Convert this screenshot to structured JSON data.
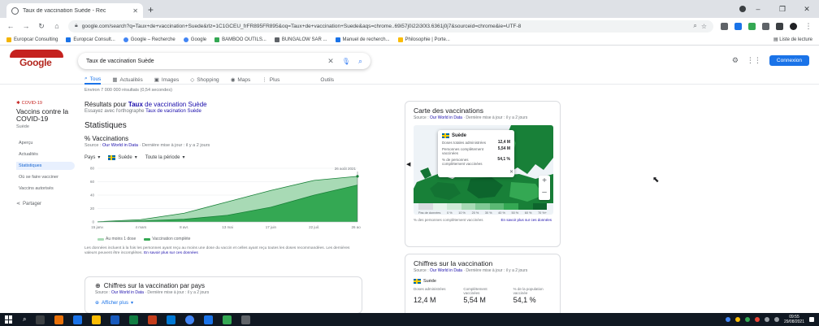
{
  "browser": {
    "tab_title": "Taux de vaccination Suède - Rec",
    "new_tab": "+",
    "url": "google.com/search?q=Taux+de+vaccination+Suede&rlz=1C1GCEU_frFR895FR895&oq=Taux+de+vaccination+Suede&aqs=chrome..69i57j0i22i30l3.6361j0j7&sourceid=chrome&ie=UTF-8",
    "window_controls": [
      "–",
      "❐",
      "✕"
    ],
    "bookmarks": [
      {
        "label": "Europcar Consulting",
        "color": "#f4b400"
      },
      {
        "label": "Europcar Consult...",
        "color": "#1a73e8"
      },
      {
        "label": "Google – Recherche",
        "color": "#4285f4"
      },
      {
        "label": "Google",
        "color": "#4285f4"
      },
      {
        "label": "BAMBOO OUTILS...",
        "color": "#34a853"
      },
      {
        "label": "BUNGALOW SAR ...",
        "color": "#5f6368"
      },
      {
        "label": "Manuel de recherch...",
        "color": "#1a73e8"
      },
      {
        "label": "Philosophie | Porte...",
        "color": "#fbbc04"
      }
    ],
    "reading_list": "Liste de lecture"
  },
  "search": {
    "logo_text": "Google",
    "query": "Taux de vaccination Suède",
    "signin": "Connexion",
    "tabs": [
      "Tous",
      "Actualités",
      "Images",
      "Shopping",
      "Maps",
      "Plus"
    ],
    "tools": "Outils",
    "result_stats": "Environ 7 000 000 résultats (0,54 secondes)"
  },
  "sidebar": {
    "tag": "COVID-19",
    "title": "Vaccins contre la COVID-19",
    "subtitle": "Suède",
    "items": [
      "Aperçu",
      "Actualités",
      "Statistiques",
      "Où se faire vacciner",
      "Vaccins autorisés"
    ],
    "share": "Partager"
  },
  "main": {
    "results_for_prefix": "Résultats pour ",
    "results_for_bold": "Taux",
    "results_for_rest": " de vaccination Suède",
    "instead_prefix": "Essayez avec l'orthographe ",
    "instead_link": "Taux de vacination Suède",
    "stats_heading": "Statistiques",
    "vacc_heading": "% Vaccinations",
    "source_prefix": "Source : ",
    "source_link": "Our World in Data",
    "source_updated": " · Dernière mise à jour : il y a 2 jours",
    "filter_scope": "Pays",
    "filter_country": "Suède",
    "filter_period": "Toute la période",
    "chart_note": "Les données incluent à la fois les personnes ayant reçu au moins une dose du vaccin et celles ayant reçu toutes les doses recommandées. Les dernières valeurs peuvent être incomplètes.",
    "chart_note_link": "En savoir plus sur ces données"
  },
  "chart_data": {
    "type": "area",
    "x": [
      "15 janv.",
      "4 mars",
      "8 avr.",
      "13 mai",
      "17 juin",
      "22 juil.",
      "26 août"
    ],
    "series": [
      {
        "name": "Au moins 1 dose",
        "values": [
          0.3,
          3.5,
          13,
          30,
          47,
          62,
          68
        ]
      },
      {
        "name": "Vaccination complète",
        "values": [
          0.1,
          1.5,
          4,
          10,
          22,
          40,
          55
        ]
      }
    ],
    "yticks": [
      "0",
      "20",
      "40",
      "60",
      "80"
    ],
    "ylim": [
      0,
      80
    ],
    "hover_label": "26 août 2021",
    "colors": {
      "dose1": "#a8dab5",
      "full": "#34a853",
      "line": "#188038"
    }
  },
  "country_card": {
    "title": "Chiffres sur la vaccination par pays",
    "source": "Our World in Data",
    "updated": " · Dernière mise à jour : il y a 2 jours",
    "button": "Afficher plus"
  },
  "knowledge_panel": {
    "title": "Carte des vaccinations",
    "source": "Our World in Data",
    "updated": " · Dernière mise à jour : il y a 2 jours",
    "tooltip": {
      "country": "Suède",
      "rows": [
        {
          "label": "Doses totales administrées",
          "value": "12,4 M"
        },
        {
          "label": "Personnes complètement vaccinées",
          "value": "5,54 M"
        },
        {
          "label": "% de personnes complètement vaccinées",
          "value": "54,1 %"
        }
      ]
    },
    "zoom_in": "+",
    "zoom_out": "–",
    "close": "✕",
    "scale_labels": [
      "Pas de données",
      "0 %",
      "10 %",
      "20 %",
      "30 %",
      "40 %",
      "50 %",
      "60 %",
      "70 %+"
    ],
    "foot_left": "% des personnes complètement vaccinées",
    "foot_link": "En savoir plus sur ces données"
  },
  "knowledge_panel2": {
    "title": "Chiffres sur la vaccination",
    "source": "Our World in Data",
    "updated": " · Dernière mise à jour : il y a 2 jours",
    "country": "Suède",
    "stats": [
      {
        "label": "Doses administrées",
        "value": "12,4 M"
      },
      {
        "label": "Complètement vaccinées",
        "value": "5,54 M"
      },
      {
        "label": "% de la population vaccinée",
        "value": "54,1 %"
      }
    ]
  },
  "taskbar": {
    "time": "09:55",
    "date": "29/08/2021"
  }
}
